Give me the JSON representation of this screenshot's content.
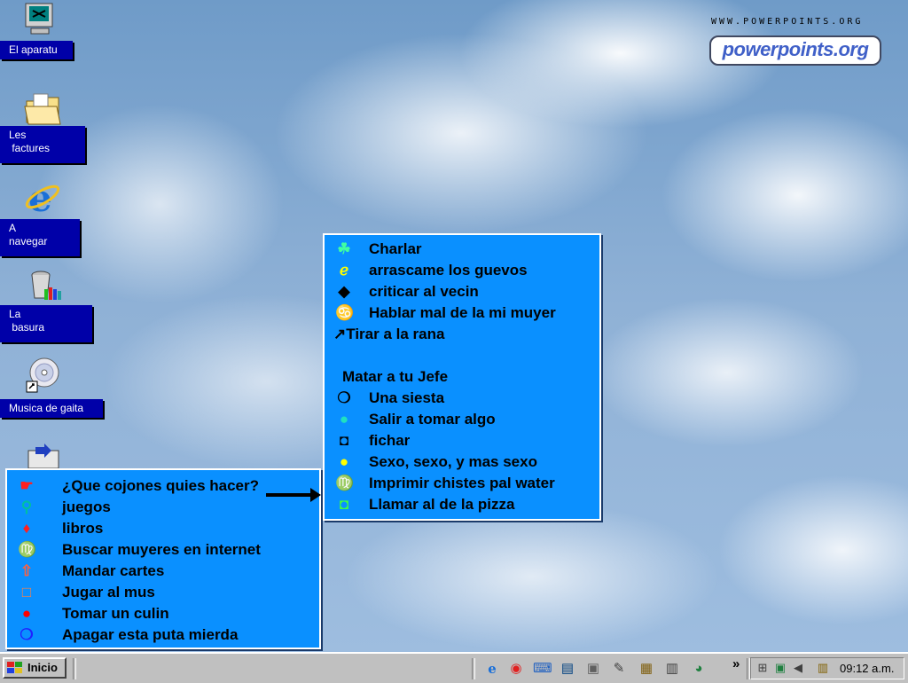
{
  "desktop_icons": [
    {
      "label": "El aparatu",
      "icon": "computer-icon"
    },
    {
      "label": "Les\n factures",
      "icon": "folder-icon"
    },
    {
      "label": "A\nnavegar",
      "icon": "internet-explorer-icon"
    },
    {
      "label": "La\n basura",
      "icon": "recycle-bin-icon"
    },
    {
      "label": "Musica de gaita",
      "icon": "cd-icon"
    },
    {
      "label": "",
      "icon": "outbox-icon"
    }
  ],
  "branding": {
    "url": "WWW.POWERPOINTS.ORG",
    "logo": "powerpoints.org"
  },
  "start_menu": {
    "items": [
      {
        "bullet": "☛",
        "bullet_color": "#ff2020",
        "label": "¿Que cojones quies hacer?"
      },
      {
        "bullet": "⚲",
        "bullet_color": "#00c0a0",
        "label": "juegos"
      },
      {
        "bullet": "♦",
        "bullet_color": "#ff2020",
        "label": "libros"
      },
      {
        "bullet": "♍",
        "bullet_color": "#ffff00",
        "label": "Buscar muyeres en internet"
      },
      {
        "bullet": "⇧",
        "bullet_color": "#ff6040",
        "label": "Mandar cartes"
      },
      {
        "bullet": "□",
        "bullet_color": "#ff8040",
        "label": "Jugar al mus"
      },
      {
        "bullet": "●",
        "bullet_color": "#ff0000",
        "label": "Tomar un culin"
      },
      {
        "bullet": "❍",
        "bullet_color": "#2020ff",
        "label": "Apagar esta puta mierda"
      }
    ]
  },
  "submenu": {
    "items": [
      {
        "bullet": "☘",
        "bullet_color": "#40ffa0",
        "label": "Charlar"
      },
      {
        "bullet": "ℯ",
        "bullet_color": "#ffff00",
        "label": "arrascame los guevos"
      },
      {
        "bullet": "◆",
        "bullet_color": "#000000",
        "label": "criticar al vecin"
      },
      {
        "bullet": "♋",
        "bullet_color": "#000000",
        "label": "Hablar mal de la mi muyer"
      },
      {
        "bullet": "",
        "bullet_color": "#000000",
        "label": "↗Tirar a la rana"
      },
      {
        "bullet": "",
        "bullet_color": "#000000",
        "label": ""
      },
      {
        "bullet": "",
        "bullet_color": "#000000",
        "label": "Matar a tu Jefe"
      },
      {
        "bullet": "❍",
        "bullet_color": "#000000",
        "label": "Una siesta"
      },
      {
        "bullet": "●",
        "bullet_color": "#20e0c0",
        "label": "Salir a tomar algo"
      },
      {
        "bullet": "◘",
        "bullet_color": "#000000",
        "label": "fichar"
      },
      {
        "bullet": "●",
        "bullet_color": "#ffff00",
        "label": "Sexo, sexo, y mas sexo"
      },
      {
        "bullet": "♍",
        "bullet_color": "#ff2020",
        "label": "Imprimir chistes pal water"
      },
      {
        "bullet": "◘",
        "bullet_color": "#40ff40",
        "label": "Llamar al de la pizza"
      }
    ]
  },
  "taskbar": {
    "start_label": "Inicio",
    "quick_launch": [
      "internet-explorer-icon",
      "outlook-icon",
      "desktop-icon",
      "channels-icon",
      "network-icon",
      "help-icon",
      "folder-tree-icon",
      "document-icon",
      "globe-icon"
    ],
    "overflow": "»",
    "clock": "09:12 a.m."
  }
}
